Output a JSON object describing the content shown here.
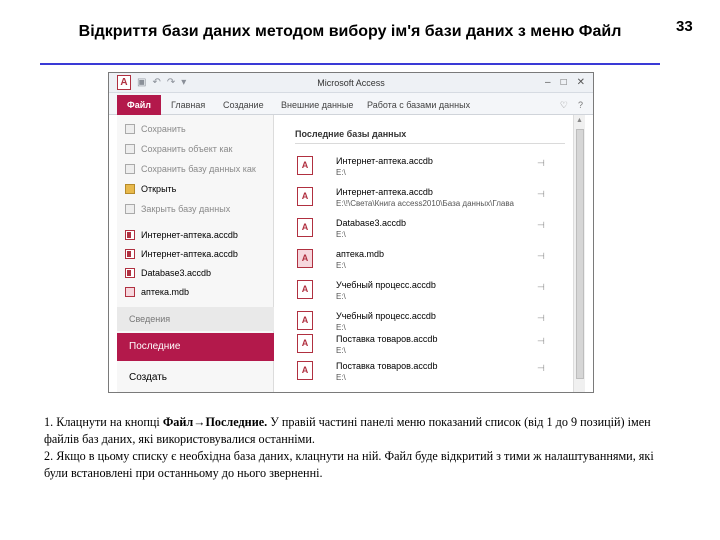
{
  "slide": {
    "title": "Відкриття бази даних методом вибору ім'я бази даних з меню Файл",
    "page_number": "33"
  },
  "window": {
    "title": "Microsoft Access",
    "app_icon": "A",
    "quick_access": [
      "▣",
      "↶",
      "↷",
      "▾"
    ],
    "controls": [
      "–",
      "□",
      "✕"
    ],
    "help_controls": [
      "♡",
      "?"
    ]
  },
  "ribbon": {
    "file_tab": "Файл",
    "tabs": [
      "Главная",
      "Создание",
      "Внешние данные",
      "Работа с базами данных"
    ]
  },
  "backstage": {
    "commands": [
      {
        "label": "Сохранить",
        "dim": true
      },
      {
        "label": "Сохранить объект как",
        "dim": true
      },
      {
        "label": "Сохранить базу данных как",
        "dim": true
      },
      {
        "label": "Открыть",
        "dim": false
      },
      {
        "label": "Закрыть базу данных",
        "dim": true
      }
    ],
    "recent_files": [
      {
        "label": "Интернет-аптека.accdb"
      },
      {
        "label": "Интернет-аптека.accdb"
      },
      {
        "label": "Database3.accdb"
      },
      {
        "label": "аптека.mdb"
      }
    ],
    "info_label": "Сведения",
    "active_label": "Последние",
    "create_label": "Создать"
  },
  "recent": {
    "header": "Последние базы данных",
    "items": [
      {
        "name": "Интернет-аптека.accdb",
        "path": "E:\\",
        "type": "accdb"
      },
      {
        "name": "Интернет-аптека.accdb",
        "path": "E:\\!\\Света\\Книга access2010\\База данных\\Глава",
        "type": "accdb"
      },
      {
        "name": "Database3.accdb",
        "path": "E:\\",
        "type": "accdb"
      },
      {
        "name": "аптека.mdb",
        "path": "E:\\",
        "type": "mdb"
      },
      {
        "name": "Учебный процесс.accdb",
        "path": "E:\\",
        "type": "accdb"
      },
      {
        "name": "Учебный процесс.accdb",
        "path": "E:\\",
        "type": "accdb"
      },
      {
        "name": "Поставка товаров.accdb",
        "path": "E:\\",
        "type": "accdb"
      },
      {
        "name": "Поставка товаров.accdb",
        "path": "E:\\",
        "type": "accdb"
      }
    ]
  },
  "caption": {
    "p1_a": "1. Клацнути на кнопці ",
    "p1_bold": "Файл→Последние.",
    "p1_b": " У правій частині панелі меню показаний список (від 1 до 9 позицій) імен файлів баз даних, які використовувалися останніми.",
    "p2": "2. Якщо в цьому списку є необхідна база даних, клацнути на ній. Файл буде відкритий з тими ж налаштуваннями, які були встановлені при останньому до нього зверненні."
  }
}
